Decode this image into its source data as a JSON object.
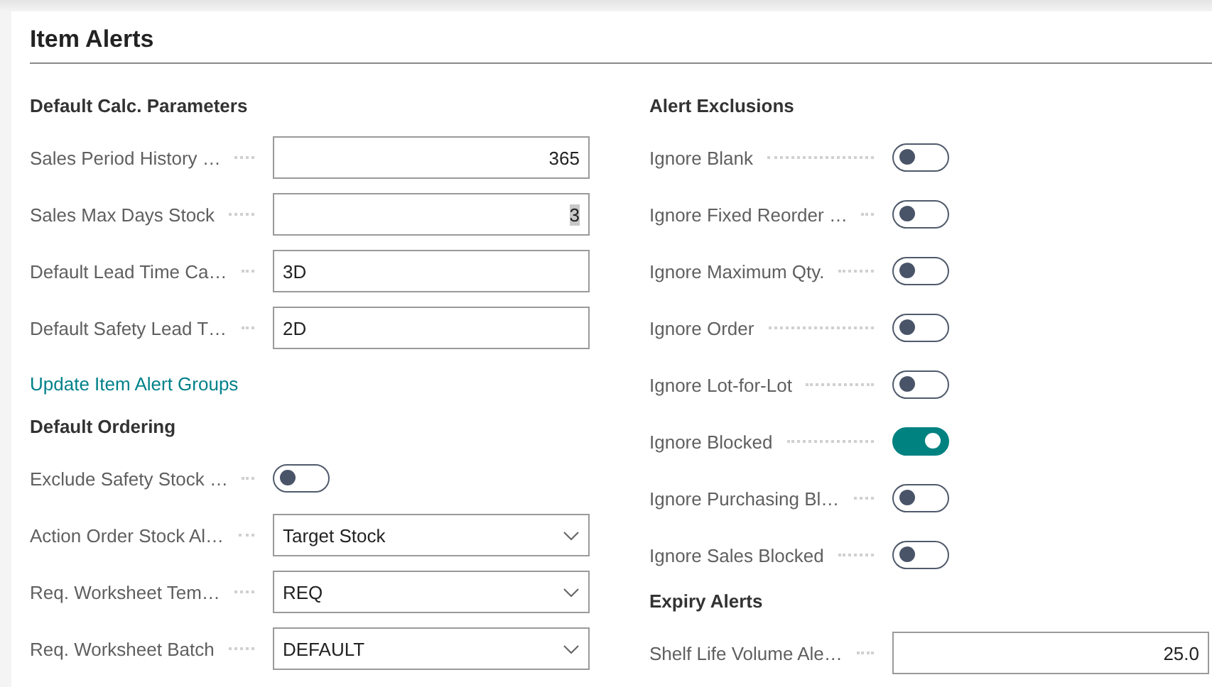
{
  "page": {
    "title": "Item Alerts"
  },
  "columns": [
    {
      "sections": [
        {
          "kind": "group",
          "heading": "Default Calc. Parameters",
          "fields": [
            {
              "kind": "number",
              "label": "Sales Period History …",
              "value": "365",
              "value_selected": false
            },
            {
              "kind": "number",
              "label": "Sales Max Days Stock",
              "value": "3",
              "value_selected": true
            },
            {
              "kind": "text",
              "label": "Default Lead Time Ca…",
              "value": "3D",
              "value_selected": false
            },
            {
              "kind": "text",
              "label": "Default Safety Lead T…",
              "value": "2D",
              "value_selected": false
            }
          ]
        },
        {
          "kind": "link",
          "text": "Update Item Alert Groups"
        },
        {
          "kind": "group",
          "heading": "Default Ordering",
          "fields": [
            {
              "kind": "toggle",
              "label": "Exclude Safety Stock …",
              "on": false
            },
            {
              "kind": "select",
              "label": "Action Order Stock Al…",
              "value": "Target Stock"
            },
            {
              "kind": "select",
              "label": "Req. Worksheet Tem…",
              "value": "REQ"
            },
            {
              "kind": "select",
              "label": "Req. Worksheet Batch",
              "value": "DEFAULT"
            }
          ]
        }
      ]
    },
    {
      "sections": [
        {
          "kind": "group",
          "heading": "Alert Exclusions",
          "fields": [
            {
              "kind": "toggle",
              "label": "Ignore Blank",
              "on": false
            },
            {
              "kind": "toggle",
              "label": "Ignore Fixed Reorder …",
              "on": false
            },
            {
              "kind": "toggle",
              "label": "Ignore Maximum Qty.",
              "on": false
            },
            {
              "kind": "toggle",
              "label": "Ignore Order",
              "on": false
            },
            {
              "kind": "toggle",
              "label": "Ignore Lot-for-Lot",
              "on": false
            },
            {
              "kind": "toggle",
              "label": "Ignore Blocked",
              "on": true
            },
            {
              "kind": "toggle",
              "label": "Ignore Purchasing Bl…",
              "on": false
            },
            {
              "kind": "toggle",
              "label": "Ignore Sales Blocked",
              "on": false
            }
          ]
        },
        {
          "kind": "group",
          "heading": "Expiry Alerts",
          "fields": [
            {
              "kind": "number",
              "label": "Shelf Life Volume Ale…",
              "value": "25.0",
              "value_selected": false
            }
          ]
        }
      ]
    }
  ]
}
